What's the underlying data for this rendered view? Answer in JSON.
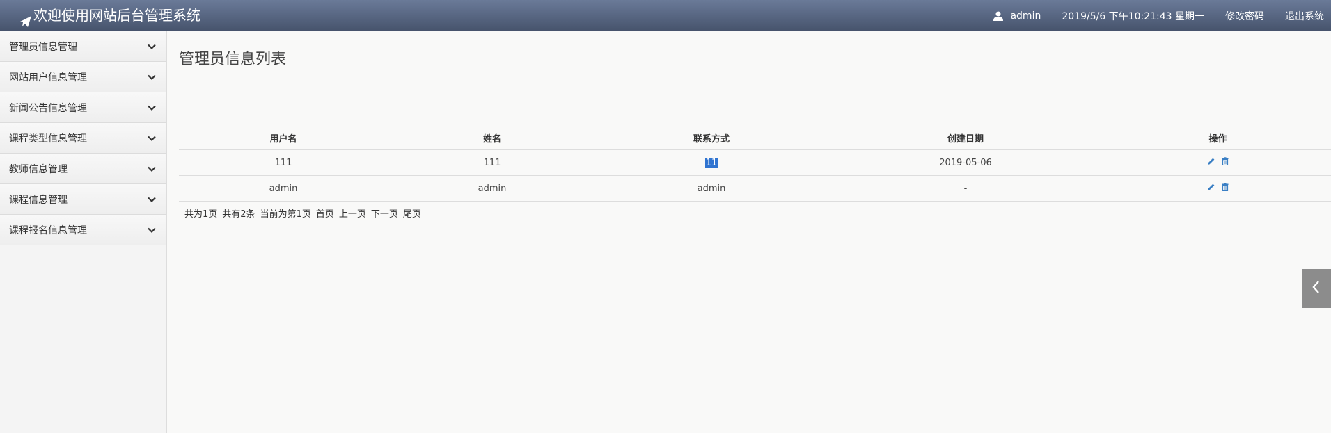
{
  "header": {
    "title": "欢迎使用网站后台管理系统",
    "username": "admin",
    "datetime": "2019/5/6 下午10:21:43 星期一",
    "change_password": "修改密码",
    "logout": "退出系统"
  },
  "sidebar": {
    "items": [
      {
        "label": "管理员信息管理"
      },
      {
        "label": "网站用户信息管理"
      },
      {
        "label": "新闻公告信息管理"
      },
      {
        "label": "课程类型信息管理"
      },
      {
        "label": "教师信息管理"
      },
      {
        "label": "课程信息管理"
      },
      {
        "label": "课程报名信息管理"
      }
    ]
  },
  "main": {
    "title": "管理员信息列表",
    "table": {
      "headers": [
        "用户名",
        "姓名",
        "联系方式",
        "创建日期",
        "操作"
      ],
      "rows": [
        [
          "111",
          "111",
          "11",
          "2019-05-06"
        ],
        [
          "admin",
          "admin",
          "admin",
          "-"
        ]
      ]
    },
    "pager": {
      "total_pages": "共为1页",
      "total_records": "共有2条",
      "current_page": "当前为第1页",
      "first": "首页",
      "prev": "上一页",
      "next": "下一页",
      "last": "尾页"
    }
  },
  "icons": {
    "logo": "paper-plane-icon",
    "user": "user-icon",
    "chevron": "chevron-down-icon",
    "edit": "pencil-icon",
    "delete": "trash-icon",
    "toggle": "chevron-left-icon"
  },
  "colors": {
    "header_top": "#6a7a98",
    "header_bottom": "#46536c",
    "action_icon": "#3a7fc4",
    "selection": "#3074d0",
    "toggle_bg": "#8c8c8c"
  }
}
